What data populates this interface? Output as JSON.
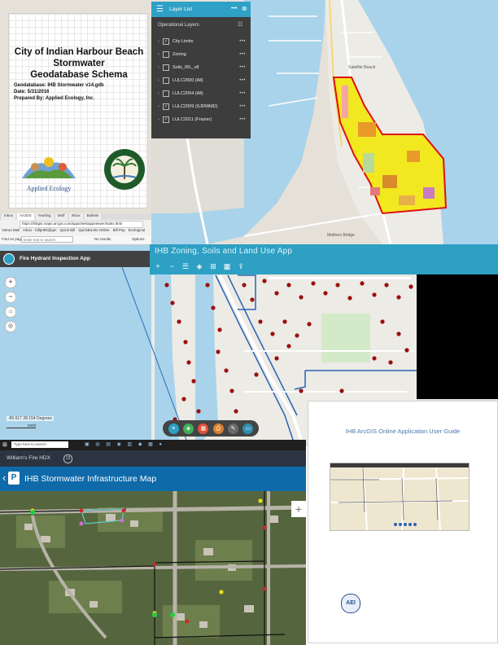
{
  "geodb": {
    "title_lines": [
      "City of Indian Harbour Beach",
      "Stormwater",
      "Geodatabase Schema"
    ],
    "geodatabase": "Geodatabase:  IHB Stormwater v14.gdb",
    "date": "Date:  5/31/2016",
    "prepared_by": "Prepared By: Applied Ecology, Inc.",
    "logo_text": "Applied Ecology",
    "seal_text": "INDIAN HARBOUR BEACH FLORIDA"
  },
  "layer_list": {
    "title": "Layer List",
    "section": "Operational Layers",
    "layers": [
      {
        "label": "City Limits",
        "checked": true
      },
      {
        "label": "Zoning",
        "checked": false
      },
      {
        "label": "Soils_IRL_v8",
        "checked": false
      },
      {
        "label": "LULC2000 (All)",
        "checked": false
      },
      {
        "label": "LULC2004 (All)",
        "checked": false
      },
      {
        "label": "LULC2009 (SJRWMD)",
        "checked": true
      },
      {
        "label": "LULC2011 (Frazier)",
        "checked": true
      }
    ]
  },
  "map_labels": {
    "satellite": "Satellite Beach",
    "mathers": "Mathers Bridge"
  },
  "browser": {
    "tabs": [
      "Inbox",
      "ArcGIS",
      "Yearling",
      "Wolf",
      "Inbox",
      "Bulletin"
    ],
    "url": "https://ihbgis.maps.arcgis.com/apps/webappviewer/index.html",
    "find_label": "Find on page",
    "find_placeholder": "Enter text to search",
    "no_results": "No results",
    "options": "Options",
    "bookmarks": [
      "Yahoo Mail",
      "Inbox - billpr6tk@gm",
      "Quick Bill",
      "QuickBooks Online",
      "Bill Pay",
      "Ecological"
    ]
  },
  "fire_app": {
    "title": "Fire Hydrant Inspection App",
    "coords": "-80.617 28.154 Degrees",
    "scale": "600ft"
  },
  "zoning_app": {
    "title": "IHB Zoning, Soils and Land Use App"
  },
  "taskbar": {
    "search": "Type here to search"
  },
  "storm_app": {
    "device": "William's Fire HDX",
    "badge": "13",
    "title": "IHB Stormwater Infrastructure Map"
  },
  "guide": {
    "title": "IHB ArcGIS Online Application User Guide",
    "logo": "AEI"
  },
  "colors": {
    "app_blue": "#2da0c4",
    "storm_blue": "#0f6aaa",
    "city_limits": "#e02020",
    "hydrant": "#9b0f0f"
  }
}
